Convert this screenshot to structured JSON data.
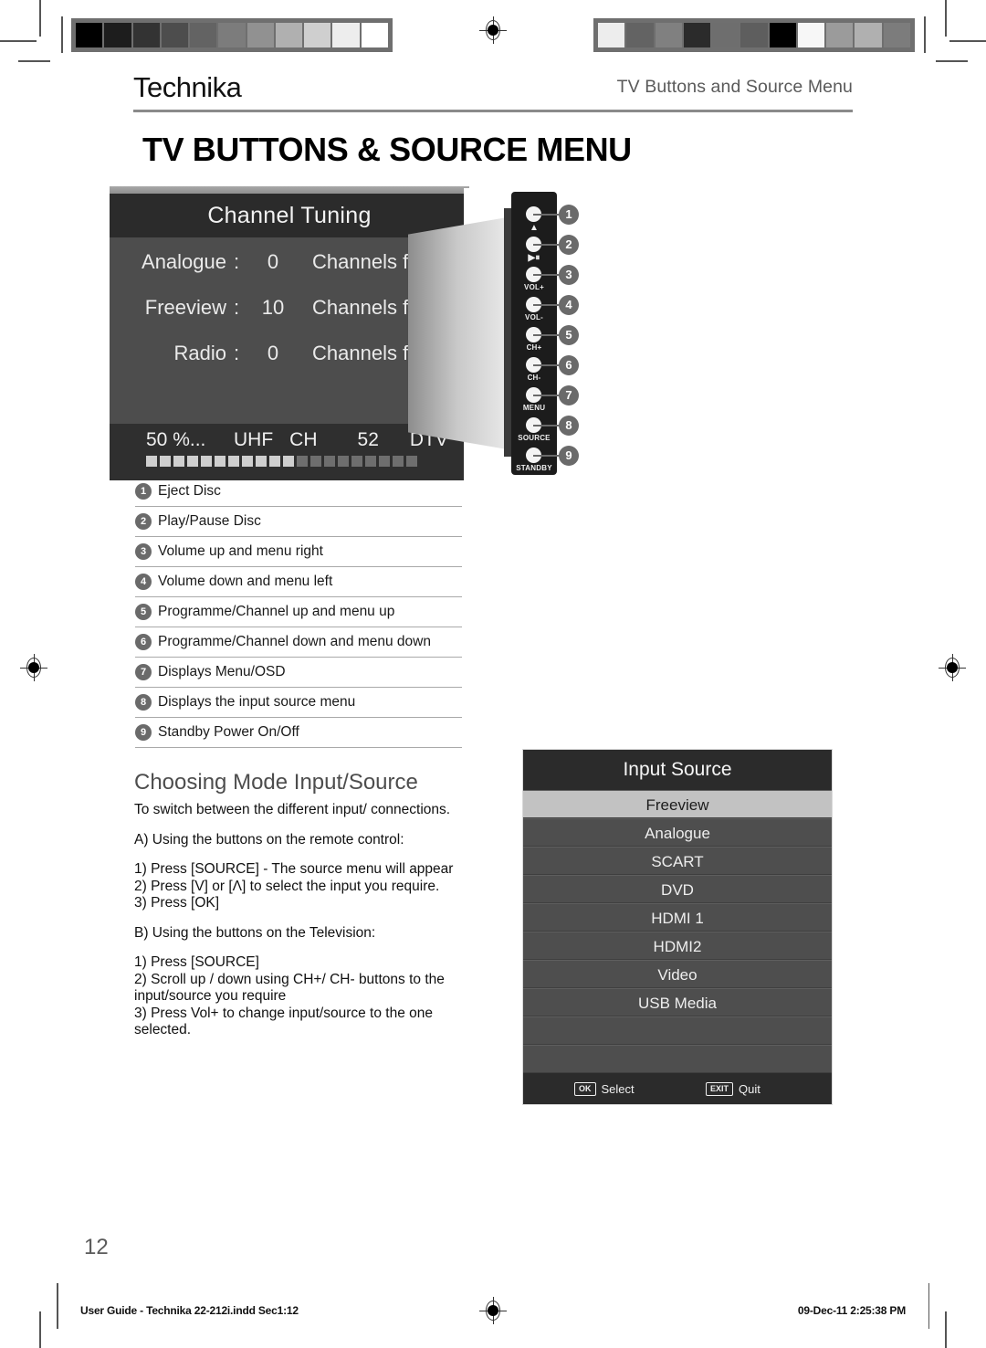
{
  "header": {
    "brand": "Technika",
    "running_head": "TV Buttons and Source Menu",
    "page_title": "TV BUTTONS & SOURCE MENU"
  },
  "tv_osd": {
    "title": "Channel Tuning",
    "rows": [
      {
        "label": "Analogue",
        "colon": ":",
        "count": "0",
        "found": "Channels found"
      },
      {
        "label": "Freeview",
        "colon": ":",
        "count": "10",
        "found": "Channels found"
      },
      {
        "label": "Radio",
        "colon": ":",
        "count": "0",
        "found": "Channels found"
      }
    ],
    "status": {
      "percent": "50 %...",
      "band": "UHF",
      "ch_label": "CH",
      "channel": "52",
      "mode": "DTV"
    },
    "progress": {
      "total_blocks": 20,
      "filled_blocks": 11,
      "filled_color": "#cfcfcf",
      "empty_color": "#6e6e6e"
    }
  },
  "button_panel": {
    "buttons": [
      {
        "callout": "1",
        "label": "▲"
      },
      {
        "callout": "2",
        "label": "▶⏸"
      },
      {
        "callout": "3",
        "label": "VOL+"
      },
      {
        "callout": "4",
        "label": "VOL-"
      },
      {
        "callout": "5",
        "label": "CH+"
      },
      {
        "callout": "6",
        "label": "CH-"
      },
      {
        "callout": "7",
        "label": "MENU"
      },
      {
        "callout": "8",
        "label": "SOURCE"
      },
      {
        "callout": "9",
        "label": "STANDBY"
      }
    ]
  },
  "legend": {
    "items": [
      {
        "num": "1",
        "text": "Eject Disc"
      },
      {
        "num": "2",
        "text": "Play/Pause Disc"
      },
      {
        "num": "3",
        "text": "Volume up and menu right"
      },
      {
        "num": "4",
        "text": "Volume down and menu left"
      },
      {
        "num": "5",
        "text": "Programme/Channel up and menu up"
      },
      {
        "num": "6",
        "text": "Programme/Channel down and menu down"
      },
      {
        "num": "7",
        "text": "Displays Menu/OSD"
      },
      {
        "num": "8",
        "text": "Displays the input source menu"
      },
      {
        "num": "9",
        "text": "Standby Power On/Off"
      }
    ]
  },
  "choosing_mode": {
    "heading": "Choosing Mode Input/Source",
    "paragraphs": [
      "To switch between the different input/ connections.",
      "A) Using the buttons on the remote control:",
      "1) Press [SOURCE] - The source menu will appear\n2) Press [V] or [Λ] to select the input you require.\n3) Press [OK]",
      "B) Using the buttons on the Television:",
      "1) Press [SOURCE]\n2) Scroll up / down using CH+/ CH- buttons to the input/source you require\n3) Press Vol+ to change input/source to the one selected."
    ]
  },
  "input_source": {
    "title": "Input Source",
    "items": [
      {
        "label": "Freeview",
        "selected": true
      },
      {
        "label": "Analogue",
        "selected": false
      },
      {
        "label": "SCART",
        "selected": false
      },
      {
        "label": "DVD",
        "selected": false
      },
      {
        "label": "HDMI 1",
        "selected": false
      },
      {
        "label": "HDMI2",
        "selected": false
      },
      {
        "label": "Video",
        "selected": false
      },
      {
        "label": "USB Media",
        "selected": false
      },
      {
        "label": "",
        "selected": false
      },
      {
        "label": "",
        "selected": false
      }
    ],
    "footer": {
      "ok_key": "OK",
      "ok_action": "Select",
      "exit_key": "EXIT",
      "exit_action": "Quit"
    }
  },
  "footer": {
    "page_number": "12",
    "file_info": "User Guide - Technika 22-212i.indd   Sec1:12",
    "timestamp": "09-Dec-11   2:25:38 PM"
  },
  "colorbars": {
    "left": [
      "#000000",
      "#1d1d1d",
      "#333333",
      "#4d4d4d",
      "#636363",
      "#7c7c7c",
      "#919191",
      "#b0b0b0",
      "#cfcfcf",
      "#ededed",
      "#ffffff"
    ],
    "right": [
      "#ededed",
      "#636363",
      "#808080",
      "#2b2b2b",
      "#6e6e6e",
      "#5e5e5e",
      "#000000",
      "#f7f7f7",
      "#9b9b9b",
      "#b0b0b0",
      "#7c7c7c"
    ]
  }
}
